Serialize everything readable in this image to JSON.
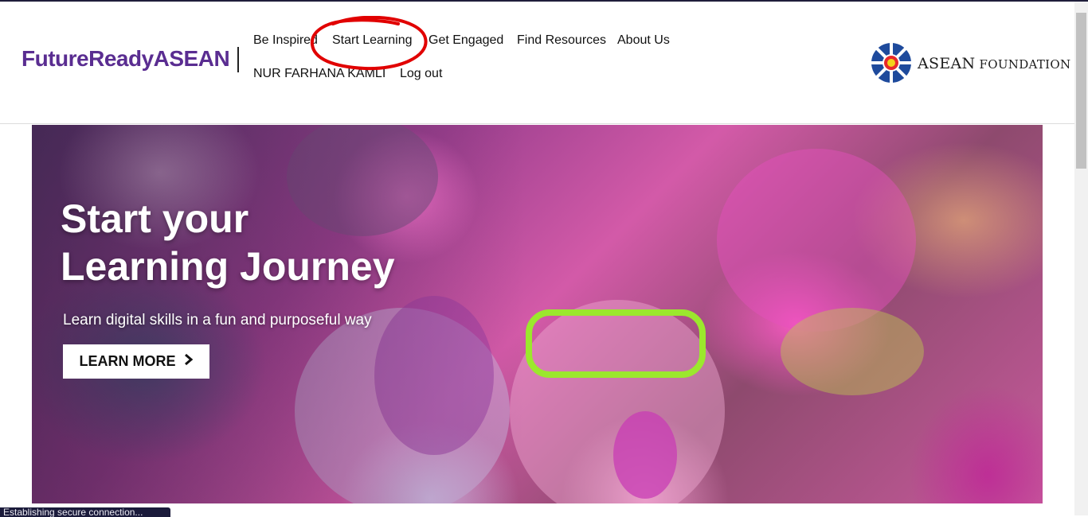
{
  "header": {
    "logo": {
      "text": "FutureReadyASEAN"
    },
    "nav": {
      "be_inspired": "Be Inspired",
      "start_learning": "Start Learning",
      "get_engaged": "Get Engaged",
      "find_resources": "Find Resources",
      "about_us": "About Us",
      "user_name": "NUR FARHANA KAMLI",
      "log_out": "Log out"
    },
    "partner": {
      "name_first": "ASEAN",
      "name_second": "FOUNDATION"
    }
  },
  "hero": {
    "title_line1": "Start your",
    "title_line2": "Learning Journey",
    "subtitle": "Learn digital skills in a fun and purposeful way",
    "cta_label": "LEARN MORE",
    "cta_icon": "chevron-right-icon"
  },
  "annotation": {
    "color": "#e10000",
    "target": "Start Learning"
  },
  "browser": {
    "status_text": "Establishing secure connection..."
  },
  "colors": {
    "brand": "#5a2d91",
    "cta_bg": "#ffffff",
    "annotation": "#e10000"
  }
}
